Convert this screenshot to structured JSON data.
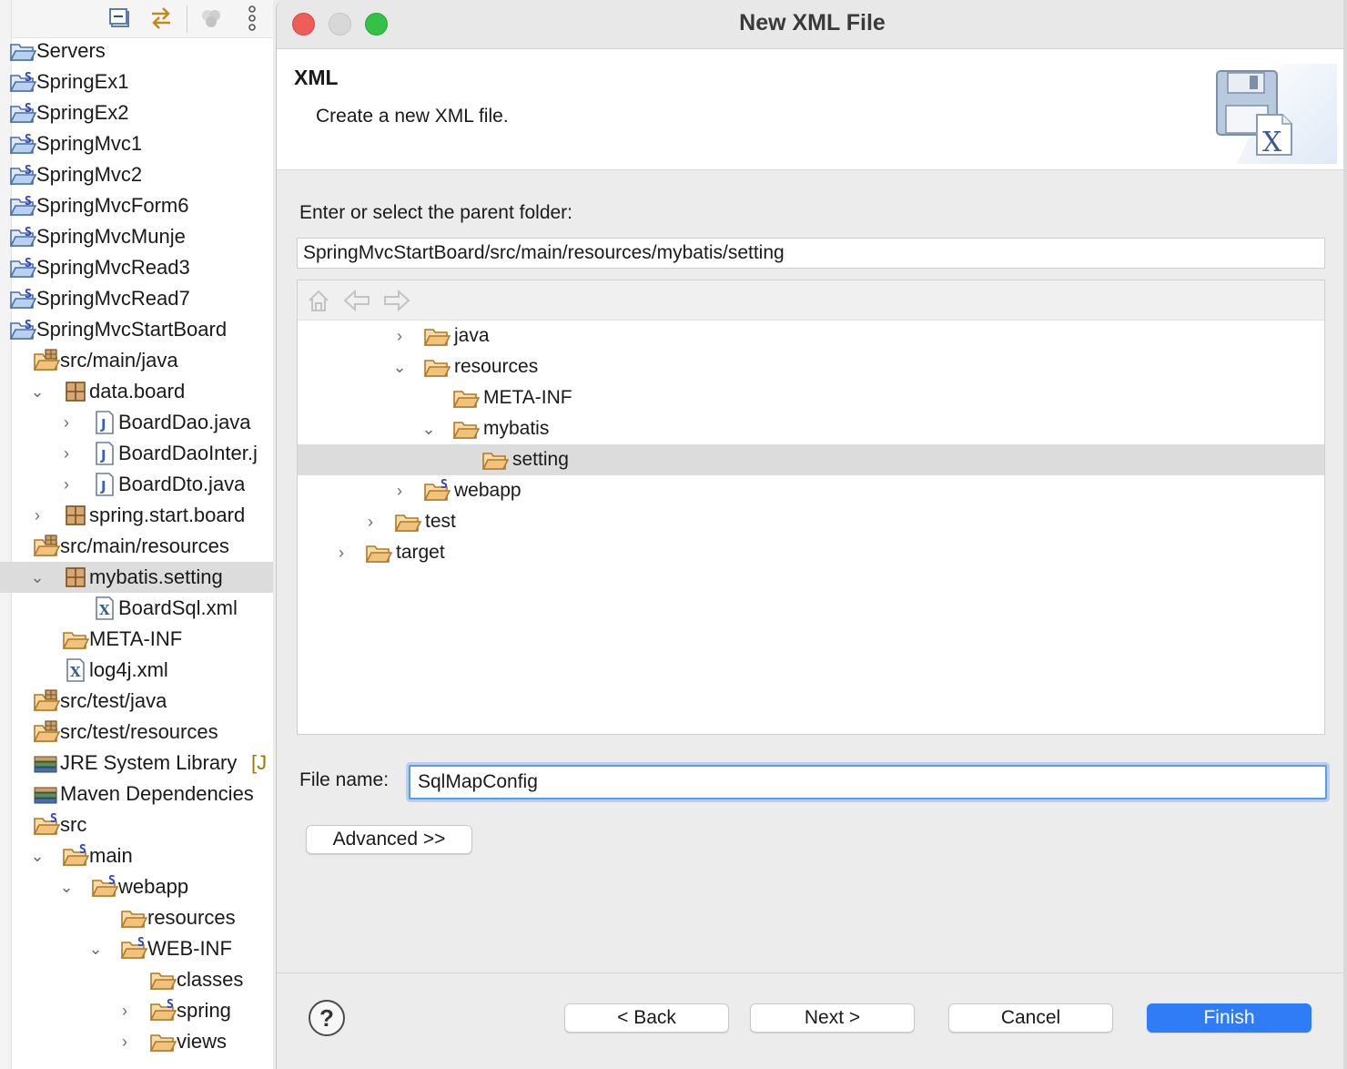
{
  "explorer": {
    "toolbar_icons": [
      "collapse-all-icon",
      "link-with-editor-icon",
      "filter-icon",
      "view-menu-icon"
    ],
    "items": [
      {
        "label": "Servers",
        "icon": "project-folder-icon"
      },
      {
        "label": "SpringEx1",
        "icon": "spring-project-icon"
      },
      {
        "label": "SpringEx2",
        "icon": "spring-project-icon"
      },
      {
        "label": "SpringMvc1",
        "icon": "spring-project-icon"
      },
      {
        "label": "SpringMvc2",
        "icon": "spring-project-icon"
      },
      {
        "label": "SpringMvcForm6",
        "icon": "spring-project-icon"
      },
      {
        "label": "SpringMvcMunje",
        "icon": "spring-project-icon"
      },
      {
        "label": "SpringMvcRead3",
        "icon": "spring-project-icon"
      },
      {
        "label": "SpringMvcRead7",
        "icon": "spring-project-icon"
      },
      {
        "label": "SpringMvcStartBoard",
        "icon": "spring-project-icon"
      },
      {
        "label": "src/main/java",
        "icon": "source-folder-icon"
      },
      {
        "label": "data.board",
        "icon": "package-icon"
      },
      {
        "label": "BoardDao.java",
        "icon": "java-file-icon"
      },
      {
        "label": "BoardDaoInter.j",
        "icon": "java-file-icon"
      },
      {
        "label": "BoardDto.java",
        "icon": "java-file-icon"
      },
      {
        "label": "spring.start.board",
        "icon": "package-icon"
      },
      {
        "label": "src/main/resources",
        "icon": "source-folder-icon"
      },
      {
        "label": "mybatis.setting",
        "icon": "package-icon"
      },
      {
        "label": "BoardSql.xml",
        "icon": "xml-file-icon"
      },
      {
        "label": "META-INF",
        "icon": "folder-icon"
      },
      {
        "label": "log4j.xml",
        "icon": "xml-file-icon"
      },
      {
        "label": "src/test/java",
        "icon": "source-folder-icon"
      },
      {
        "label": "src/test/resources",
        "icon": "source-folder-icon"
      },
      {
        "label": "JRE System Library",
        "suffix": "[J",
        "icon": "library-icon"
      },
      {
        "label": "Maven Dependencies",
        "icon": "library-icon"
      },
      {
        "label": "src",
        "icon": "spring-folder-icon"
      },
      {
        "label": "main",
        "icon": "spring-folder-icon"
      },
      {
        "label": "webapp",
        "icon": "spring-folder-icon"
      },
      {
        "label": "resources",
        "icon": "folder-icon"
      },
      {
        "label": "WEB-INF",
        "icon": "spring-folder-icon"
      },
      {
        "label": "classes",
        "icon": "folder-icon"
      },
      {
        "label": "spring",
        "icon": "spring-folder-icon"
      },
      {
        "label": "views",
        "icon": "folder-icon"
      }
    ]
  },
  "dialog": {
    "title": "New XML File",
    "banner_title": "XML",
    "banner_description": "Create a new XML file.",
    "folder_label": "Enter or select the parent folder:",
    "folder_value": "SpringMvcStartBoard/src/main/resources/mybatis/setting",
    "tree_items": [
      {
        "label": "java",
        "icon": "folder-icon"
      },
      {
        "label": "resources",
        "icon": "folder-icon"
      },
      {
        "label": "META-INF",
        "icon": "folder-icon"
      },
      {
        "label": "mybatis",
        "icon": "folder-icon"
      },
      {
        "label": "setting",
        "icon": "folder-icon"
      },
      {
        "label": "webapp",
        "icon": "spring-folder-icon"
      },
      {
        "label": "test",
        "icon": "folder-icon"
      },
      {
        "label": "target",
        "icon": "folder-icon"
      }
    ],
    "filename_label": "File name:",
    "filename_value": "SqlMapConfig",
    "advanced_label": "Advanced >>",
    "help_label": "?",
    "back_label": "< Back",
    "next_label": "Next >",
    "cancel_label": "Cancel",
    "finish_label": "Finish"
  },
  "colors": {
    "accent": "#2f7cf6",
    "close": "#ee5d57",
    "minimize": "#d8d8d8",
    "maximize": "#33c245",
    "folder": "#f1c27a",
    "spring_s": "#2a40c8"
  }
}
